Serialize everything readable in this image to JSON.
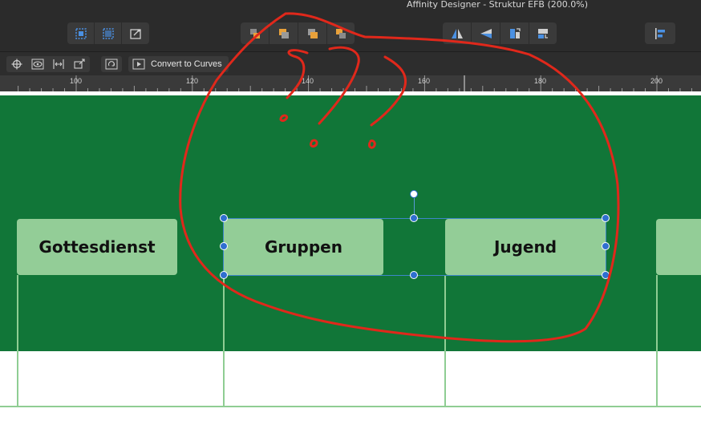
{
  "window": {
    "title": "Affinity Designer - Struktur EFB (200.0%)"
  },
  "context_toolbar": {
    "convert_label": "Convert to Curves"
  },
  "ruler": {
    "labels": [
      "100",
      "120",
      "140",
      "160",
      "180",
      "200"
    ]
  },
  "canvas": {
    "boxes": [
      "Gottesdienst",
      "Gruppen",
      "Jugend"
    ]
  },
  "colors": {
    "canvas_green": "#117638",
    "box_fill": "#93cd97",
    "selection": "#2f6fd0",
    "annotation": "#e0281b"
  }
}
